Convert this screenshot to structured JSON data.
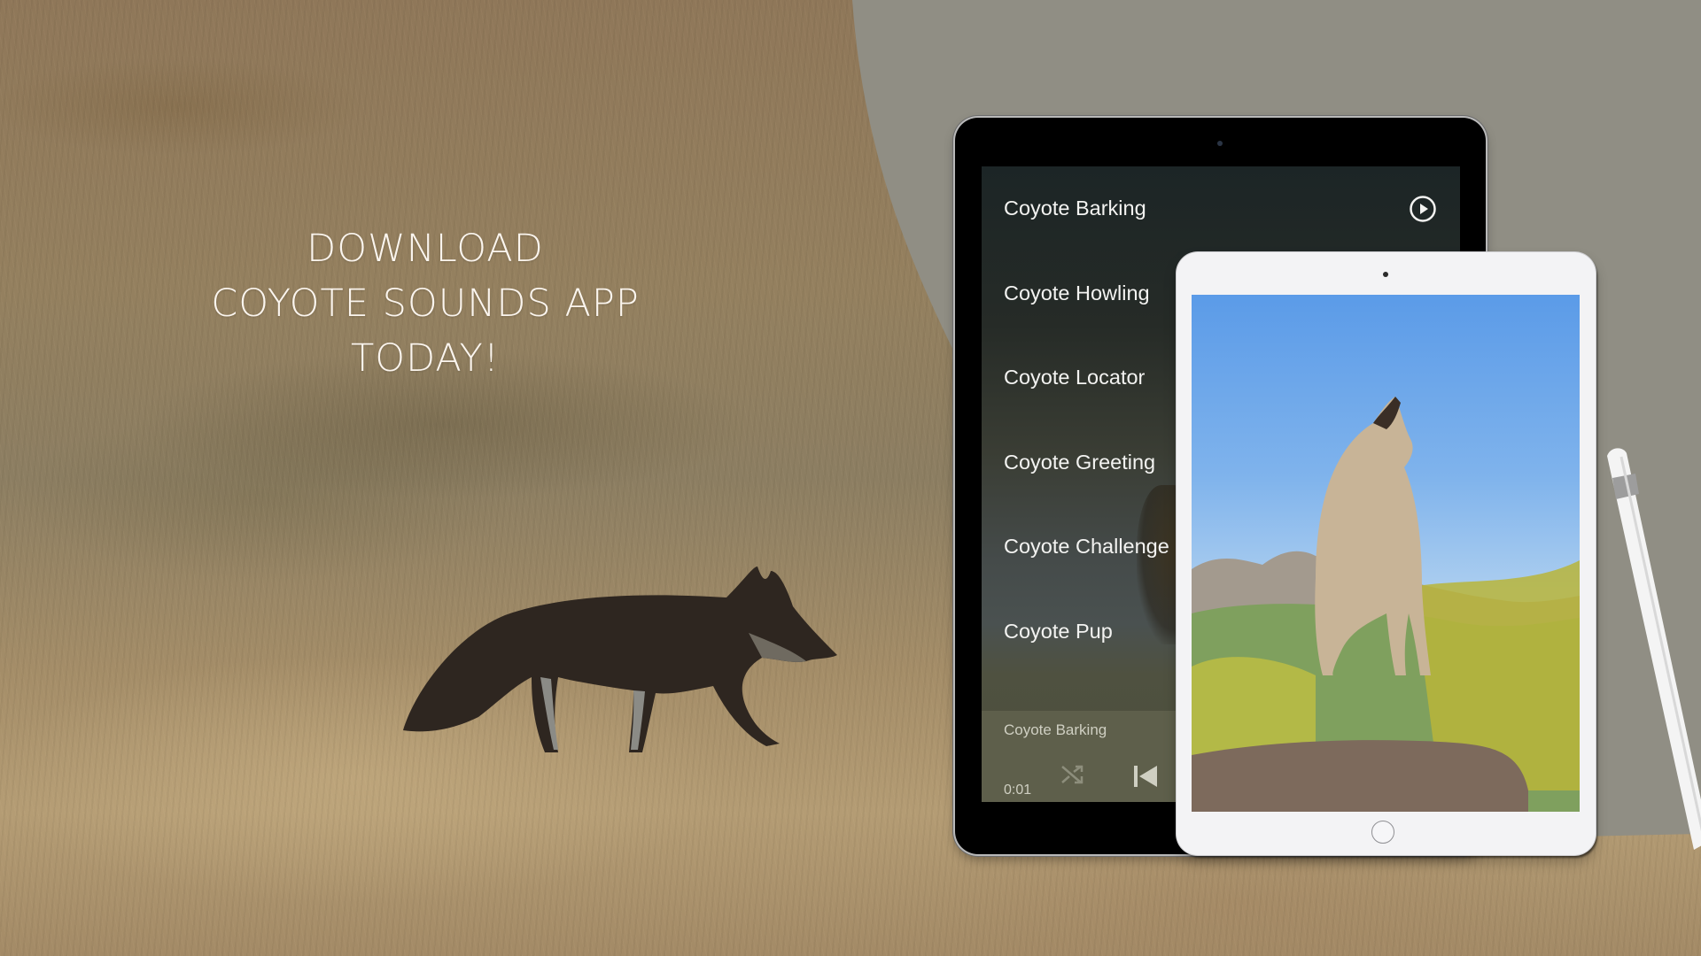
{
  "headline": {
    "lines": [
      "DOWNLOAD",
      "COYOTE SOUNDS APP",
      "TODAY!"
    ]
  },
  "colors": {
    "panel_gray": "#908e84",
    "headline_text": "#fbf5ee",
    "player_bar": "#5e5f4b",
    "track_text": "#f3f3f1"
  },
  "app": {
    "tracks": [
      {
        "label": "Coyote Barking",
        "icon": "play-circle-icon"
      },
      {
        "label": "Coyote Howling"
      },
      {
        "label": "Coyote Locator"
      },
      {
        "label": "Coyote Greeting"
      },
      {
        "label": "Coyote Challenge"
      },
      {
        "label": "Coyote Pup"
      }
    ],
    "player": {
      "now_playing": "Coyote Barking",
      "elapsed": "0:01",
      "shuffle_icon": "shuffle-icon",
      "previous_icon": "skip-previous-icon"
    }
  }
}
